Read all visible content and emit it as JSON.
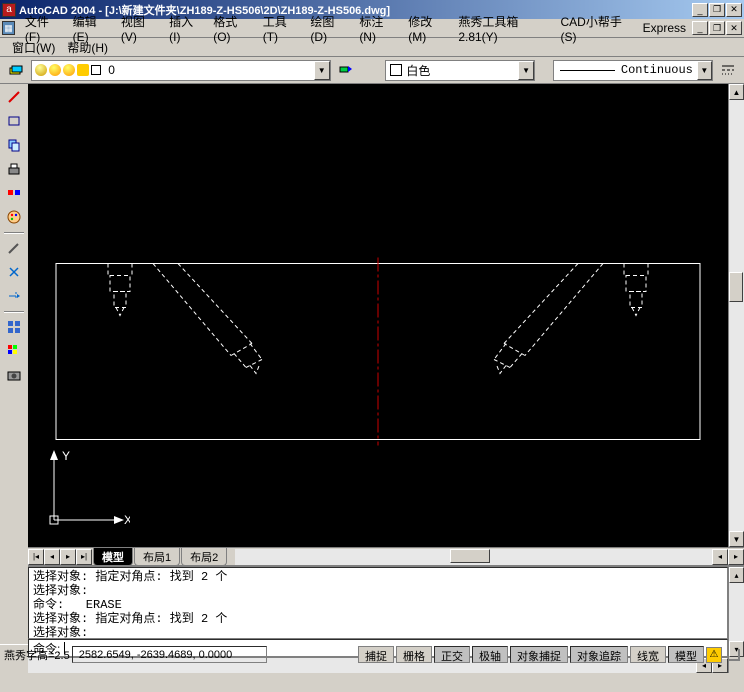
{
  "title": "AutoCAD 2004 - [J:\\新建文件夹\\ZH189-Z-HS506\\2D\\ZH189-Z-HS506.dwg]",
  "menus": {
    "file": "文件(F)",
    "edit": "编辑(E)",
    "view": "视图(V)",
    "insert": "插入(I)",
    "format": "格式(O)",
    "tools": "工具(T)",
    "draw": "绘图(D)",
    "dimension": "标注(N)",
    "modify": "修改(M)",
    "yanxiu": "燕秀工具箱2.81(Y)",
    "cadhelper": "CAD小帮手(S)",
    "express": "Express",
    "window": "窗口(W)",
    "help": "帮助(H)"
  },
  "layer": {
    "name": "0"
  },
  "color": {
    "name": "白色"
  },
  "linetype": {
    "name": "Continuous"
  },
  "tabs": {
    "model": "模型",
    "layout1": "布局1",
    "layout2": "布局2"
  },
  "ucs": {
    "x": "X",
    "y": "Y"
  },
  "cmd_history": "选择对象: 指定对角点: 找到 2 个\n选择对象:\n命令:   ERASE\n选择对象: 指定对角点: 找到 2 个\n选择对象:",
  "cmd_prompt": "命令:",
  "status": {
    "textheight_label": "燕秀字高=2.5",
    "coords": "2582.6549, -2639.4689, 0.0000",
    "snap": "捕捉",
    "grid": "栅格",
    "ortho": "正交",
    "polar": "极轴",
    "osnap": "对象捕捉",
    "otrack": "对象追踪",
    "lwt": "线宽",
    "model": "模型"
  }
}
